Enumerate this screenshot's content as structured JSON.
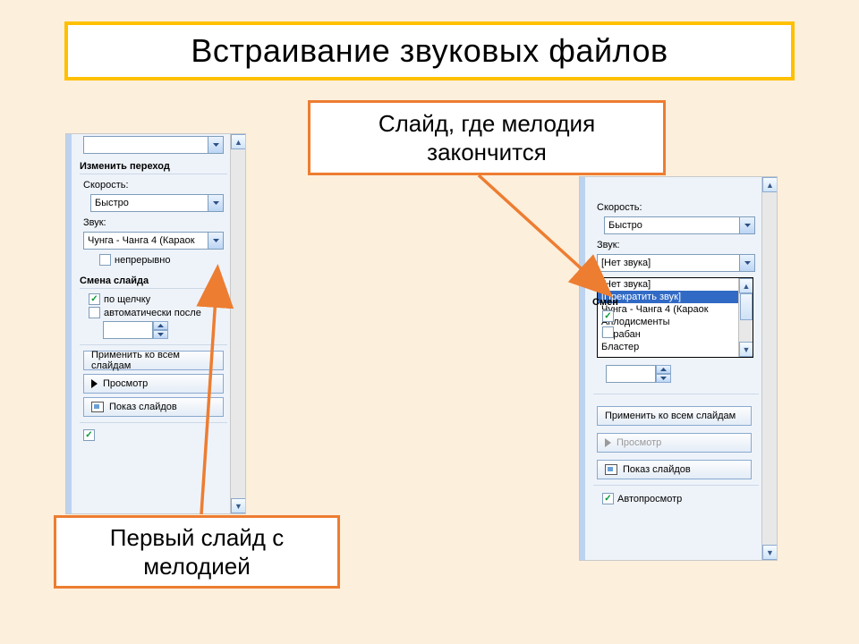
{
  "title": "Встраивание звуковых файлов",
  "callouts": {
    "top": "Слайд, где мелодия закончится",
    "bottom": "Первый слайд с мелодией"
  },
  "left_panel": {
    "section_transition": "Изменить переход",
    "speed_label": "Скорость:",
    "speed_value": "Быстро",
    "sound_label": "Звук:",
    "sound_value": "Чунга - Чанга 4 (Караок",
    "loop_label": "непрерывно",
    "section_advance": "Смена слайда",
    "on_click_label": "по щелчку",
    "auto_after_label": "автоматически после",
    "apply_all": "Применить ко всем слайдам",
    "preview": "Просмотр",
    "slideshow": "Показ слайдов"
  },
  "right_panel": {
    "speed_label": "Скорость:",
    "speed_value": "Быстро",
    "sound_label": "Звук:",
    "sound_value": "[Нет звука]",
    "dropdown_items": [
      "[Нет звука]",
      "[Прекратить звук]",
      "Чунга - Чанга 4 (Караок",
      "Аплодисменты",
      "Барабан",
      "Бластер"
    ],
    "section_advance_short": "Смен",
    "apply_all": "Применить ко всем слайдам",
    "preview": "Просмотр",
    "slideshow": "Показ слайдов",
    "autopreview": "Автопросмотр"
  },
  "colors": {
    "accent": "#ed7d31",
    "title_border": "#ffc000",
    "highlight": "#316ac5"
  }
}
